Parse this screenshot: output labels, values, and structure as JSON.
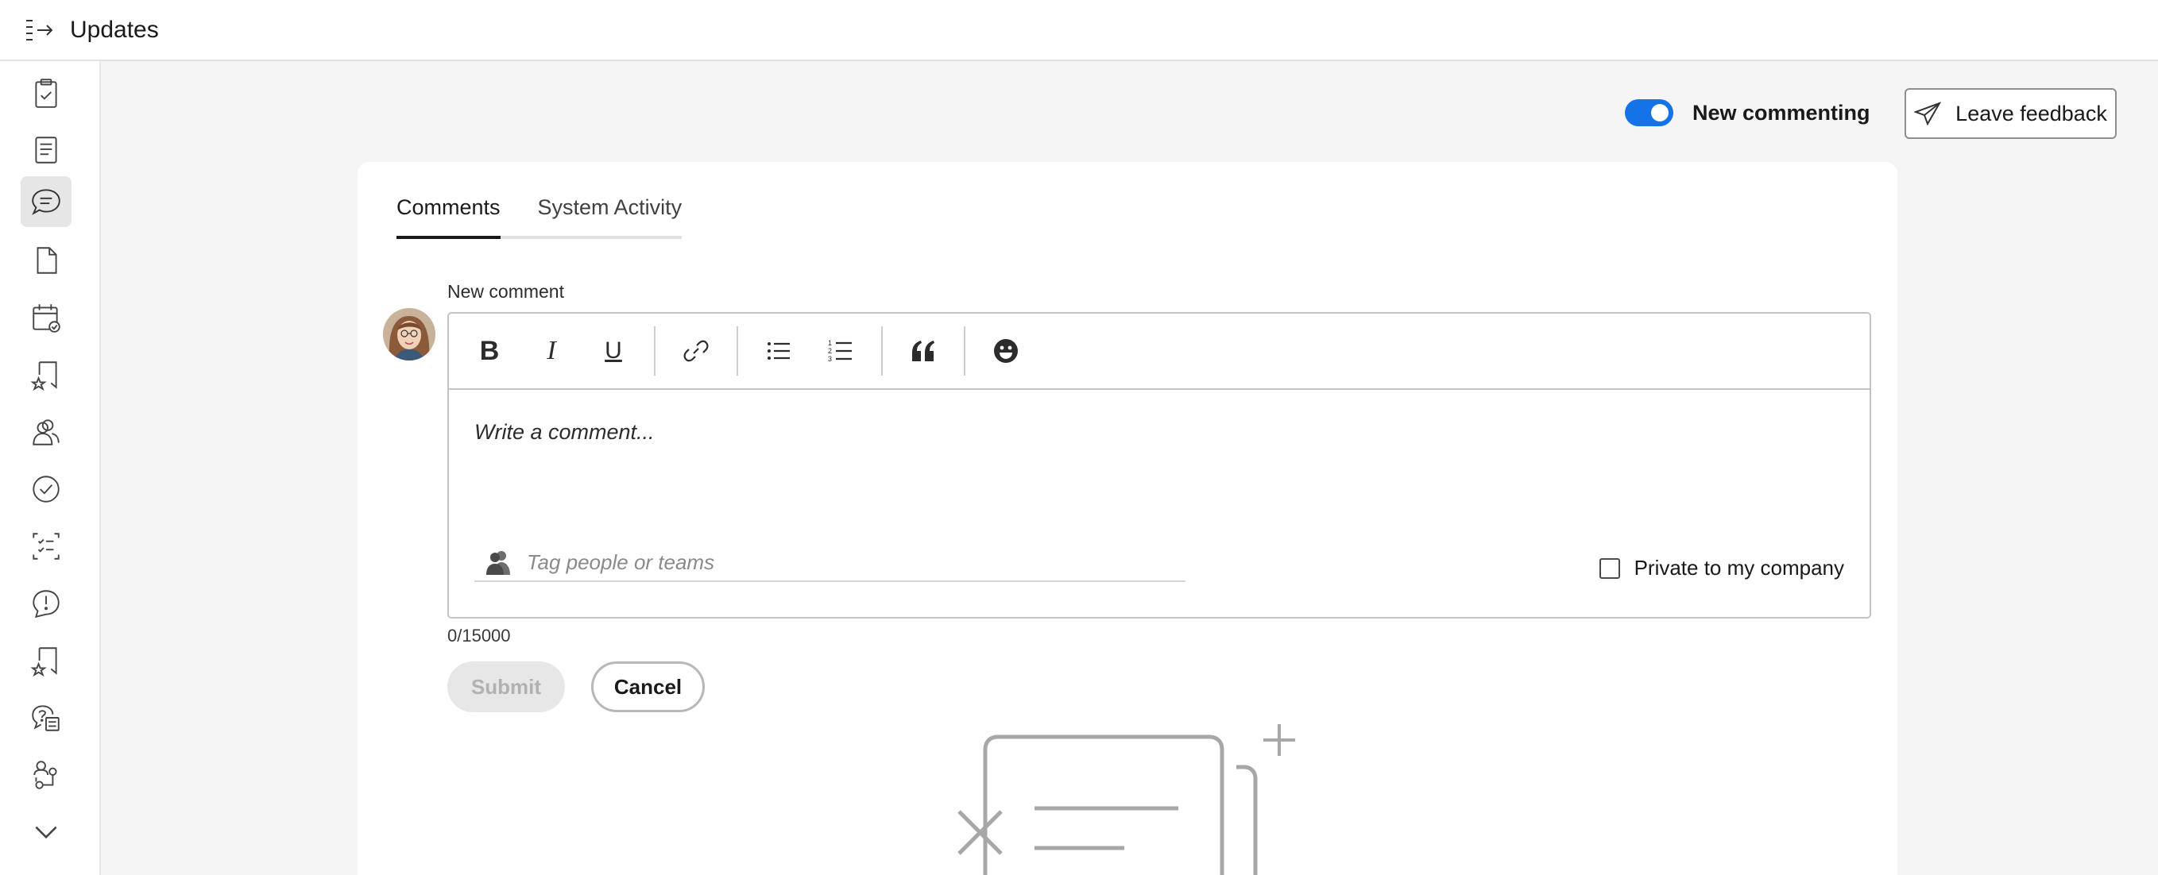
{
  "header": {
    "title": "Updates"
  },
  "sidebar": {
    "items": [
      {
        "icon": "clipboard-check-icon",
        "active": false
      },
      {
        "icon": "document-lines-icon",
        "active": false
      },
      {
        "icon": "comment-icon",
        "active": true
      },
      {
        "icon": "file-icon",
        "active": false
      },
      {
        "icon": "calendar-check-icon",
        "active": false
      },
      {
        "icon": "bookmark-star-icon",
        "active": false
      },
      {
        "icon": "people-icon",
        "active": false
      },
      {
        "icon": "checkmark-circle-icon",
        "active": false
      },
      {
        "icon": "checklist-icon",
        "active": false
      },
      {
        "icon": "alert-circle-icon",
        "active": false
      },
      {
        "icon": "bookmark-star-icon",
        "active": false
      },
      {
        "icon": "help-document-icon",
        "active": false
      },
      {
        "icon": "workflow-icon",
        "active": false
      },
      {
        "icon": "chevron-down-icon",
        "active": false
      }
    ]
  },
  "controls": {
    "new_commenting_label": "New commenting",
    "new_commenting_enabled": true,
    "feedback_label": "Leave feedback"
  },
  "tabs": [
    {
      "label": "Comments",
      "active": true
    },
    {
      "label": "System Activity",
      "active": false
    }
  ],
  "composer": {
    "label": "New comment",
    "placeholder": "Write a comment...",
    "tag_placeholder": "Tag people or teams",
    "private_label": "Private to my company",
    "private_checked": false,
    "counter": "0/15000",
    "submit_label": "Submit",
    "cancel_label": "Cancel",
    "toolbar": [
      "bold-icon",
      "italic-icon",
      "underline-icon",
      "link-icon",
      "bullet-list-icon",
      "numbered-list-icon",
      "quote-icon",
      "emoji-icon"
    ]
  },
  "colors": {
    "accent": "#1473e6",
    "page_bg": "#f5f5f5",
    "card_bg": "#ffffff"
  }
}
